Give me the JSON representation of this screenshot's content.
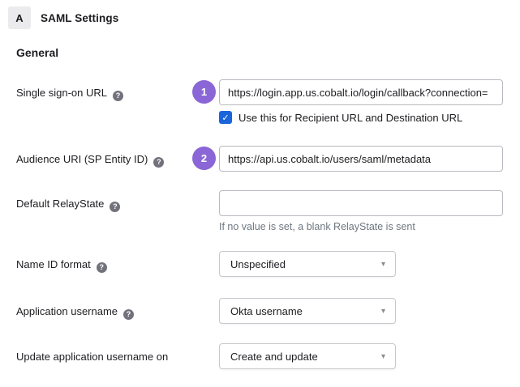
{
  "header": {
    "app_initial": "A",
    "title": "SAML Settings"
  },
  "section_title": "General",
  "icons": {
    "help": "?",
    "check": "✓",
    "caret": "▾"
  },
  "colors": {
    "badge_purple": "#8b66d6",
    "checkbox_blue": "#1b64d9",
    "helper_gray": "#6e7780",
    "app_icon_bg": "#ebebed"
  },
  "fields": {
    "sso": {
      "label": "Single sign-on URL",
      "badge": "1",
      "value": "https://login.app.us.cobalt.io/login/callback?connection=",
      "checkbox_label": "Use this for Recipient URL and Destination URL",
      "checkbox_checked": true
    },
    "audience": {
      "label": "Audience URI (SP Entity ID)",
      "badge": "2",
      "value": "https://api.us.cobalt.io/users/saml/metadata"
    },
    "relaystate": {
      "label": "Default RelayState",
      "value": "",
      "helper": "If no value is set, a blank RelayState is sent"
    },
    "nameid": {
      "label": "Name ID format",
      "value": "Unspecified"
    },
    "appusername": {
      "label": "Application username",
      "value": "Okta username"
    },
    "update_on": {
      "label": "Update application username on",
      "value": "Create and update"
    }
  }
}
